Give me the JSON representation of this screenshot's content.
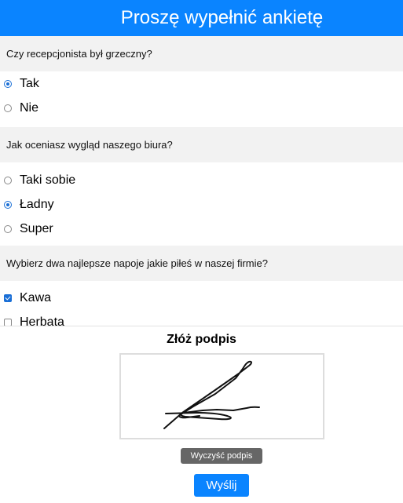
{
  "header": {
    "title": "Proszę wypełnić ankietę"
  },
  "questions": [
    {
      "text": "Czy recepcjonista był grzeczny?",
      "type": "radio",
      "options": [
        {
          "label": "Tak",
          "selected": true
        },
        {
          "label": "Nie",
          "selected": false
        }
      ]
    },
    {
      "text": "Jak oceniasz wygląd naszego biura?",
      "type": "radio",
      "options": [
        {
          "label": "Taki sobie",
          "selected": false
        },
        {
          "label": "Ładny",
          "selected": true
        },
        {
          "label": "Super",
          "selected": false
        }
      ]
    },
    {
      "text": "Wybierz dwa najlepsze napoje jakie piłeś w naszej firmie?",
      "type": "checkbox",
      "options": [
        {
          "label": "Kawa",
          "selected": true
        },
        {
          "label": "Herbata",
          "selected": false
        }
      ]
    }
  ],
  "signature": {
    "title": "Złóż podpis",
    "clear_label": "Wyczyść podpis"
  },
  "submit": {
    "label": "Wyślij"
  },
  "colors": {
    "accent": "#0a84ff",
    "question_bg": "#f2f2f2",
    "clear_button": "#666666"
  }
}
